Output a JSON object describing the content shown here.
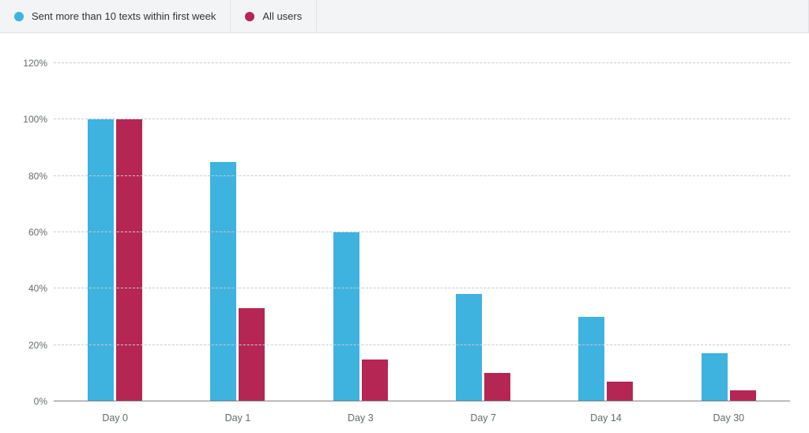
{
  "legend": [
    {
      "label": "Sent more than 10 texts within first week",
      "color": "#3eb3df"
    },
    {
      "label": "All users",
      "color": "#b52654"
    }
  ],
  "y_axis": {
    "ticks": [
      0,
      20,
      40,
      60,
      80,
      100,
      120
    ],
    "suffix": "%",
    "max": 120
  },
  "chart_data": {
    "type": "bar",
    "categories": [
      "Day 0",
      "Day 1",
      "Day 3",
      "Day 7",
      "Day 14",
      "Day 30"
    ],
    "series": [
      {
        "name": "Sent more than 10 texts within first week",
        "color": "#3eb3df",
        "values": [
          100,
          85,
          60,
          38,
          30,
          17
        ]
      },
      {
        "name": "All users",
        "color": "#b52654",
        "values": [
          100,
          33,
          15,
          10,
          7,
          4
        ]
      }
    ],
    "title": "",
    "xlabel": "",
    "ylabel": "",
    "ylim": [
      0,
      120
    ]
  }
}
